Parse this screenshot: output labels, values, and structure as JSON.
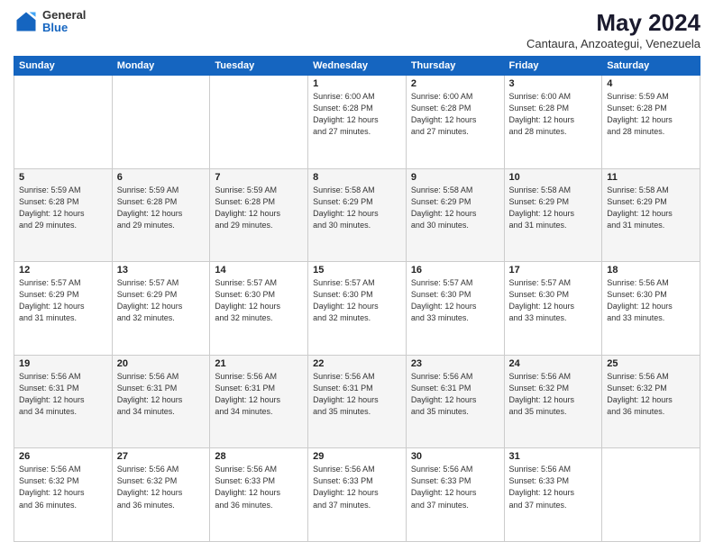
{
  "logo": {
    "general": "General",
    "blue": "Blue"
  },
  "header": {
    "title": "May 2024",
    "subtitle": "Cantaura, Anzoategui, Venezuela"
  },
  "days_of_week": [
    "Sunday",
    "Monday",
    "Tuesday",
    "Wednesday",
    "Thursday",
    "Friday",
    "Saturday"
  ],
  "weeks": [
    [
      {
        "day": "",
        "info": ""
      },
      {
        "day": "",
        "info": ""
      },
      {
        "day": "",
        "info": ""
      },
      {
        "day": "1",
        "info": "Sunrise: 6:00 AM\nSunset: 6:28 PM\nDaylight: 12 hours\nand 27 minutes."
      },
      {
        "day": "2",
        "info": "Sunrise: 6:00 AM\nSunset: 6:28 PM\nDaylight: 12 hours\nand 27 minutes."
      },
      {
        "day": "3",
        "info": "Sunrise: 6:00 AM\nSunset: 6:28 PM\nDaylight: 12 hours\nand 28 minutes."
      },
      {
        "day": "4",
        "info": "Sunrise: 5:59 AM\nSunset: 6:28 PM\nDaylight: 12 hours\nand 28 minutes."
      }
    ],
    [
      {
        "day": "5",
        "info": "Sunrise: 5:59 AM\nSunset: 6:28 PM\nDaylight: 12 hours\nand 29 minutes."
      },
      {
        "day": "6",
        "info": "Sunrise: 5:59 AM\nSunset: 6:28 PM\nDaylight: 12 hours\nand 29 minutes."
      },
      {
        "day": "7",
        "info": "Sunrise: 5:59 AM\nSunset: 6:28 PM\nDaylight: 12 hours\nand 29 minutes."
      },
      {
        "day": "8",
        "info": "Sunrise: 5:58 AM\nSunset: 6:29 PM\nDaylight: 12 hours\nand 30 minutes."
      },
      {
        "day": "9",
        "info": "Sunrise: 5:58 AM\nSunset: 6:29 PM\nDaylight: 12 hours\nand 30 minutes."
      },
      {
        "day": "10",
        "info": "Sunrise: 5:58 AM\nSunset: 6:29 PM\nDaylight: 12 hours\nand 31 minutes."
      },
      {
        "day": "11",
        "info": "Sunrise: 5:58 AM\nSunset: 6:29 PM\nDaylight: 12 hours\nand 31 minutes."
      }
    ],
    [
      {
        "day": "12",
        "info": "Sunrise: 5:57 AM\nSunset: 6:29 PM\nDaylight: 12 hours\nand 31 minutes."
      },
      {
        "day": "13",
        "info": "Sunrise: 5:57 AM\nSunset: 6:29 PM\nDaylight: 12 hours\nand 32 minutes."
      },
      {
        "day": "14",
        "info": "Sunrise: 5:57 AM\nSunset: 6:30 PM\nDaylight: 12 hours\nand 32 minutes."
      },
      {
        "day": "15",
        "info": "Sunrise: 5:57 AM\nSunset: 6:30 PM\nDaylight: 12 hours\nand 32 minutes."
      },
      {
        "day": "16",
        "info": "Sunrise: 5:57 AM\nSunset: 6:30 PM\nDaylight: 12 hours\nand 33 minutes."
      },
      {
        "day": "17",
        "info": "Sunrise: 5:57 AM\nSunset: 6:30 PM\nDaylight: 12 hours\nand 33 minutes."
      },
      {
        "day": "18",
        "info": "Sunrise: 5:56 AM\nSunset: 6:30 PM\nDaylight: 12 hours\nand 33 minutes."
      }
    ],
    [
      {
        "day": "19",
        "info": "Sunrise: 5:56 AM\nSunset: 6:31 PM\nDaylight: 12 hours\nand 34 minutes."
      },
      {
        "day": "20",
        "info": "Sunrise: 5:56 AM\nSunset: 6:31 PM\nDaylight: 12 hours\nand 34 minutes."
      },
      {
        "day": "21",
        "info": "Sunrise: 5:56 AM\nSunset: 6:31 PM\nDaylight: 12 hours\nand 34 minutes."
      },
      {
        "day": "22",
        "info": "Sunrise: 5:56 AM\nSunset: 6:31 PM\nDaylight: 12 hours\nand 35 minutes."
      },
      {
        "day": "23",
        "info": "Sunrise: 5:56 AM\nSunset: 6:31 PM\nDaylight: 12 hours\nand 35 minutes."
      },
      {
        "day": "24",
        "info": "Sunrise: 5:56 AM\nSunset: 6:32 PM\nDaylight: 12 hours\nand 35 minutes."
      },
      {
        "day": "25",
        "info": "Sunrise: 5:56 AM\nSunset: 6:32 PM\nDaylight: 12 hours\nand 36 minutes."
      }
    ],
    [
      {
        "day": "26",
        "info": "Sunrise: 5:56 AM\nSunset: 6:32 PM\nDaylight: 12 hours\nand 36 minutes."
      },
      {
        "day": "27",
        "info": "Sunrise: 5:56 AM\nSunset: 6:32 PM\nDaylight: 12 hours\nand 36 minutes."
      },
      {
        "day": "28",
        "info": "Sunrise: 5:56 AM\nSunset: 6:33 PM\nDaylight: 12 hours\nand 36 minutes."
      },
      {
        "day": "29",
        "info": "Sunrise: 5:56 AM\nSunset: 6:33 PM\nDaylight: 12 hours\nand 37 minutes."
      },
      {
        "day": "30",
        "info": "Sunrise: 5:56 AM\nSunset: 6:33 PM\nDaylight: 12 hours\nand 37 minutes."
      },
      {
        "day": "31",
        "info": "Sunrise: 5:56 AM\nSunset: 6:33 PM\nDaylight: 12 hours\nand 37 minutes."
      },
      {
        "day": "",
        "info": ""
      }
    ]
  ]
}
